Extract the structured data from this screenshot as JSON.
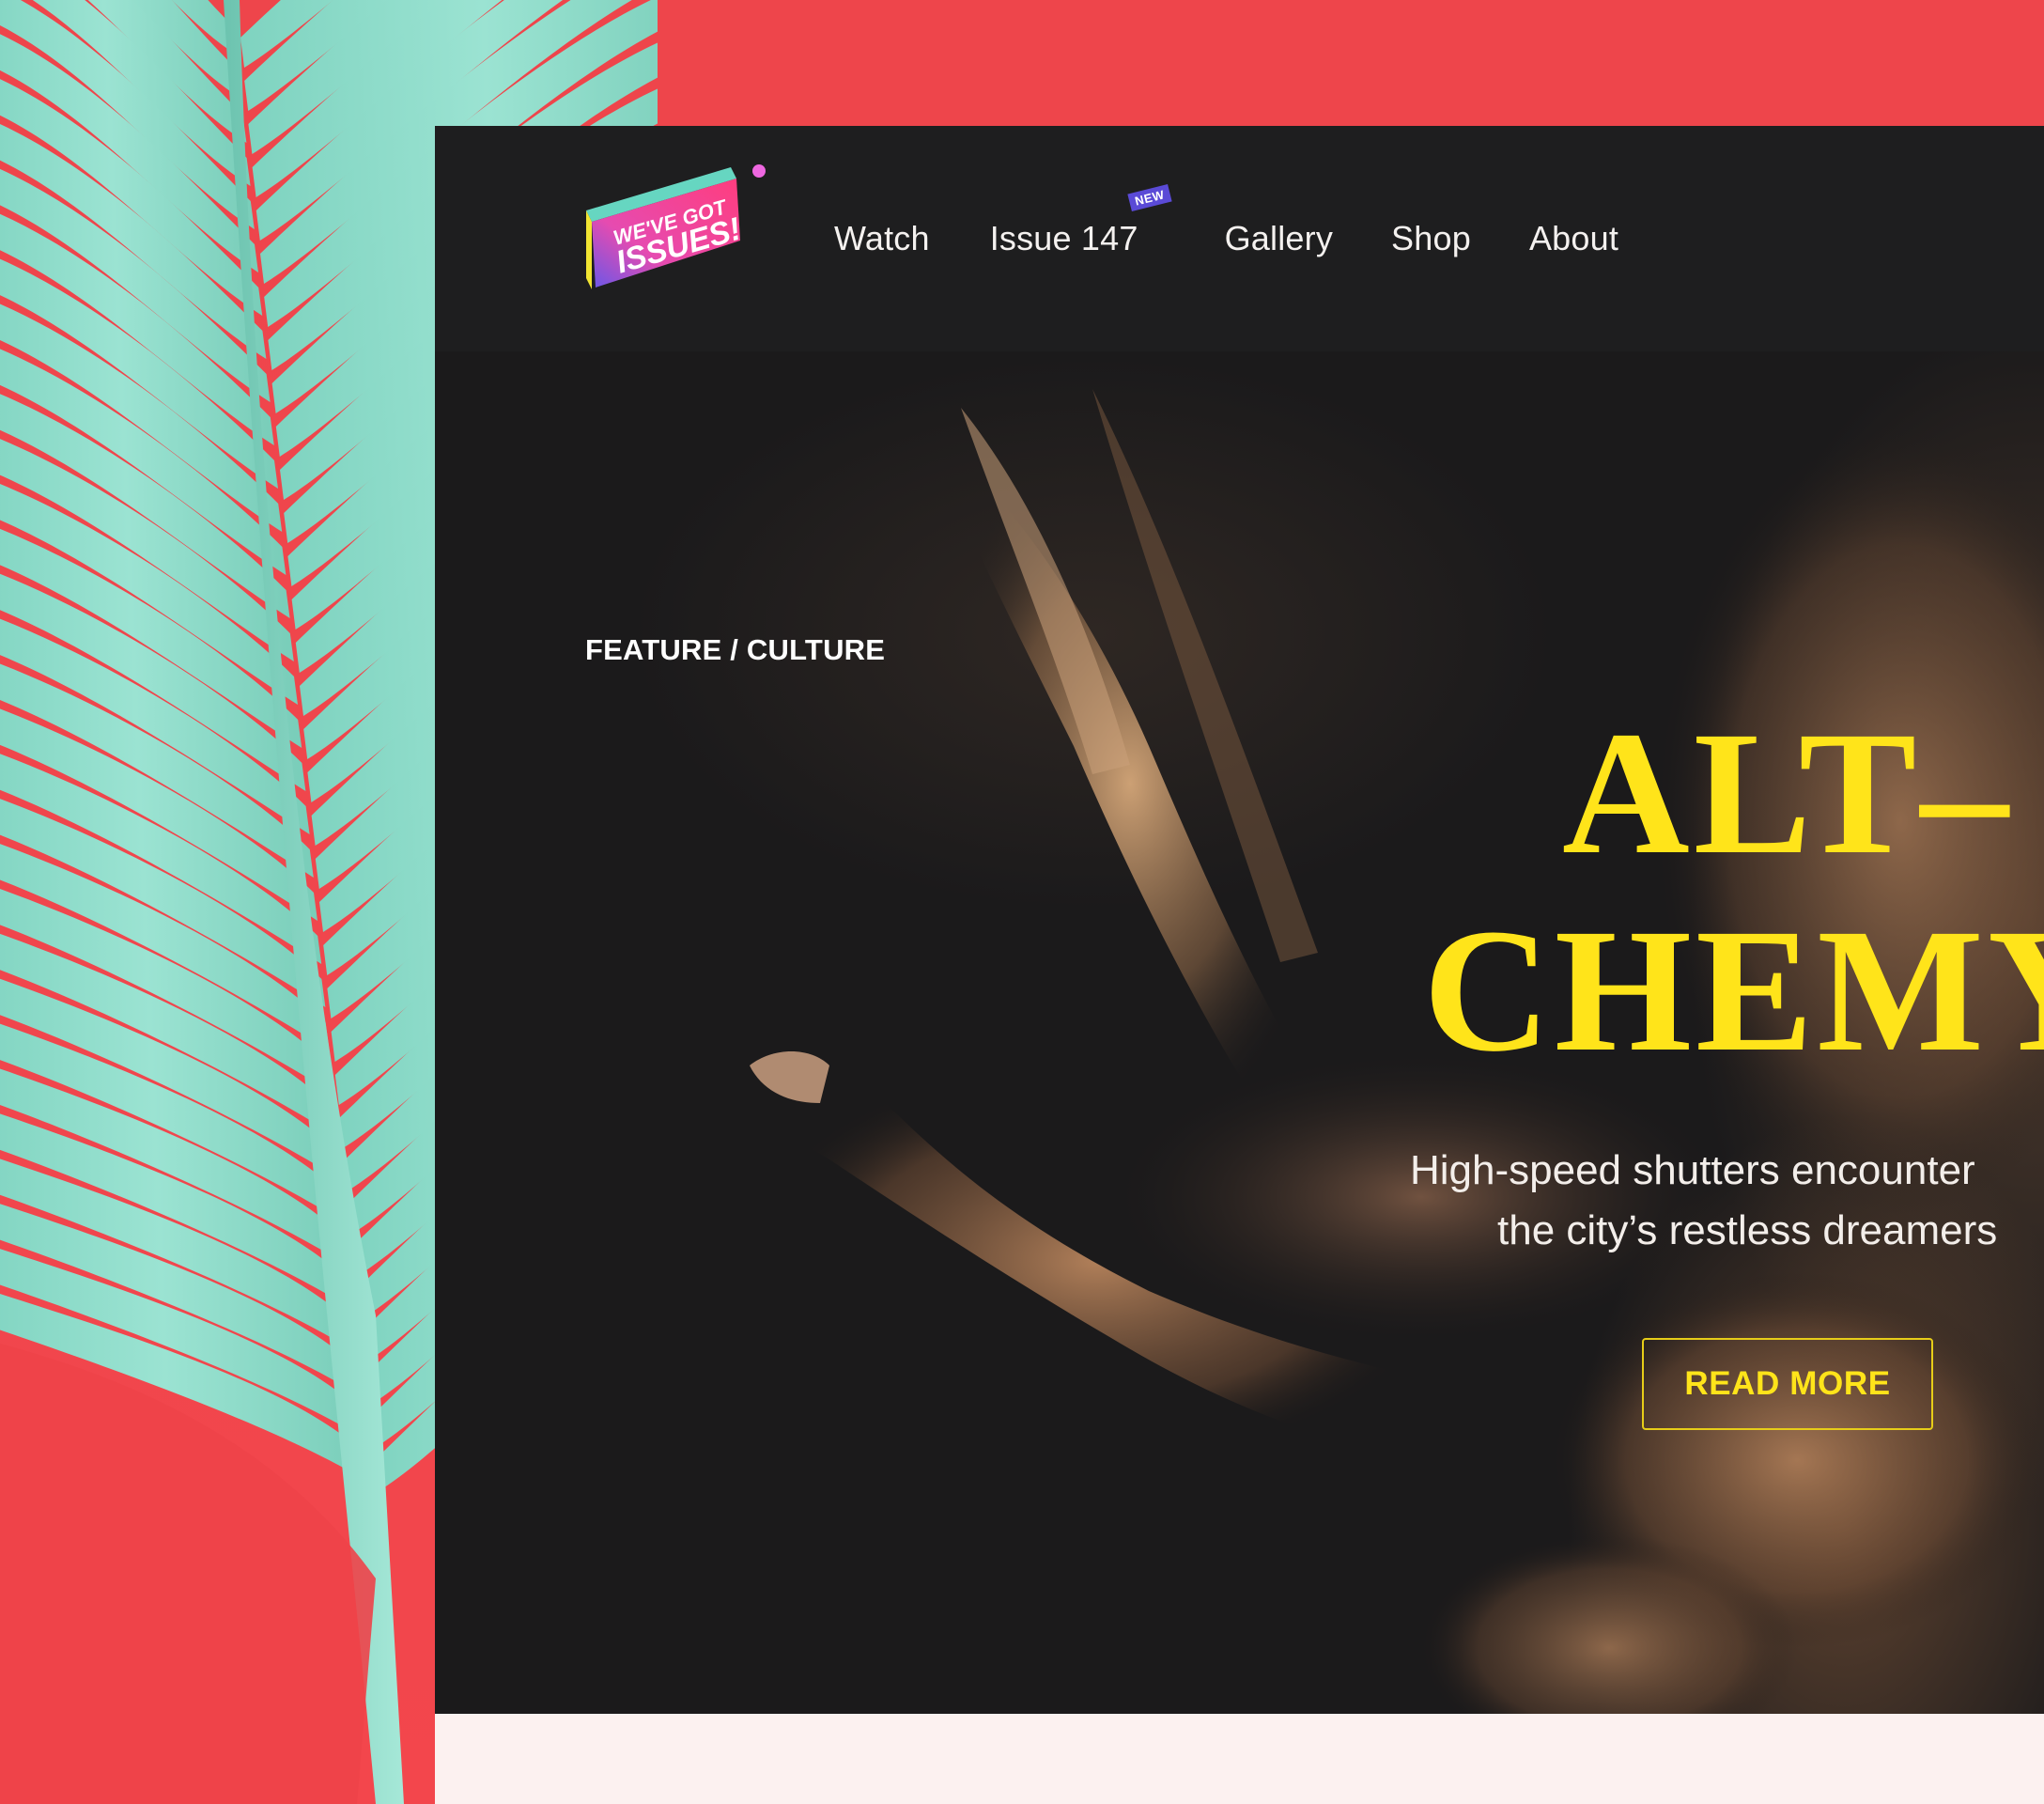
{
  "logo": {
    "line1": "WE'VE GOT",
    "line2": "ISSUES!"
  },
  "nav": {
    "items": [
      {
        "label": "Watch"
      },
      {
        "label": "Issue 147",
        "badge": "NEW"
      },
      {
        "label": "Gallery"
      },
      {
        "label": "Shop"
      },
      {
        "label": "About"
      }
    ]
  },
  "hero": {
    "kicker": "FEATURE / CULTURE",
    "headline_line1": "ALT–",
    "headline_line2": "CHEMY",
    "dek_line1": "High-speed shutters encounter",
    "dek_line2": "the city’s restless dreamers",
    "cta": "READ MORE"
  },
  "colors": {
    "background_red": "#f0464d",
    "leaf_mint": "#8ddcc9",
    "headline_yellow": "#ffe41a",
    "nav_bg": "#1e1e1f",
    "badge_purple": "#5a4ad6"
  }
}
